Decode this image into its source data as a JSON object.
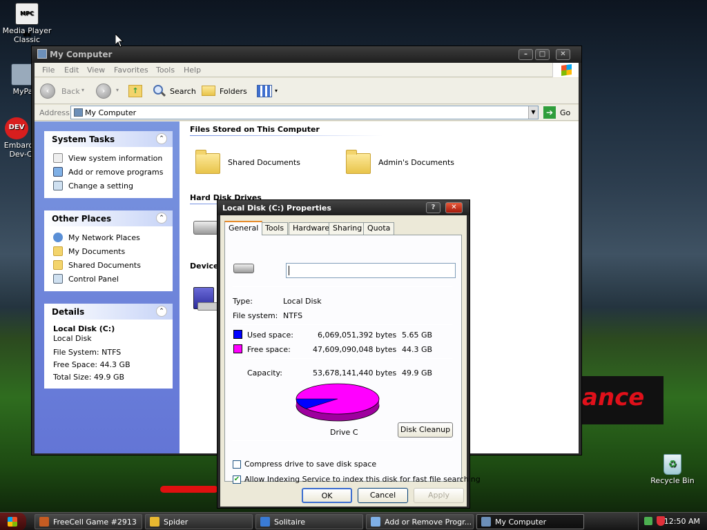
{
  "desktop": {
    "icons": [
      {
        "label": "Media Player Classic",
        "badge": "MPC BE"
      },
      {
        "label": "MyPa"
      },
      {
        "label": "Embarca Dev-C",
        "badge": "DEV"
      },
      {
        "label": "Recycle Bin"
      }
    ],
    "banner_text": "ance"
  },
  "window": {
    "title": "My Computer",
    "menu": [
      "File",
      "Edit",
      "View",
      "Favorites",
      "Tools",
      "Help"
    ],
    "toolbar": {
      "back": "Back",
      "search": "Search",
      "folders": "Folders"
    },
    "address": {
      "label": "Address",
      "value": "My Computer",
      "go": "Go"
    },
    "left": {
      "system_tasks": {
        "title": "System Tasks",
        "items": [
          "View system information",
          "Add or remove programs",
          "Change a setting"
        ]
      },
      "other_places": {
        "title": "Other Places",
        "items": [
          "My Network Places",
          "My Documents",
          "Shared Documents",
          "Control Panel"
        ]
      },
      "details": {
        "title": "Details",
        "name": "Local Disk (C:)",
        "type": "Local Disk",
        "fs": "File System: NTFS",
        "free": "Free Space: 44.3 GB",
        "total": "Total Size: 49.9 GB"
      }
    },
    "content": {
      "files_section": "Files Stored on This Computer",
      "folders": [
        "Shared Documents",
        "Admin's Documents"
      ],
      "hdd_section": "Hard Disk Drives",
      "devices_section": "Devices"
    }
  },
  "dialog": {
    "title": "Local Disk (C:) Properties",
    "help": "?",
    "close": "✕",
    "tabs": [
      "General",
      "Tools",
      "Hardware",
      "Sharing",
      "Quota"
    ],
    "name_value": "",
    "type_label": "Type:",
    "type_value": "Local Disk",
    "fs_label": "File system:",
    "fs_value": "NTFS",
    "used": {
      "label": "Used space:",
      "bytes": "6,069,051,392 bytes",
      "size": "5.65 GB",
      "color": "#0000ff",
      "fraction": 0.113
    },
    "free": {
      "label": "Free space:",
      "bytes": "47,609,090,048 bytes",
      "size": "44.3 GB",
      "color": "#ff00ff"
    },
    "capacity": {
      "label": "Capacity:",
      "bytes": "53,678,141,440 bytes",
      "size": "49.9 GB"
    },
    "drive_label": "Drive C",
    "cleanup": "Disk Cleanup",
    "compress": "Compress drive to save disk space",
    "indexing": "Allow Indexing Service to index this disk for fast file searching",
    "buttons": {
      "ok": "OK",
      "cancel": "Cancel",
      "apply": "Apply"
    }
  },
  "taskbar": {
    "items": [
      "FreeCell Game #2913",
      "Spider",
      "Solitaire",
      "Add or Remove Progr...",
      "My Computer"
    ],
    "clock": "12:50 AM"
  }
}
